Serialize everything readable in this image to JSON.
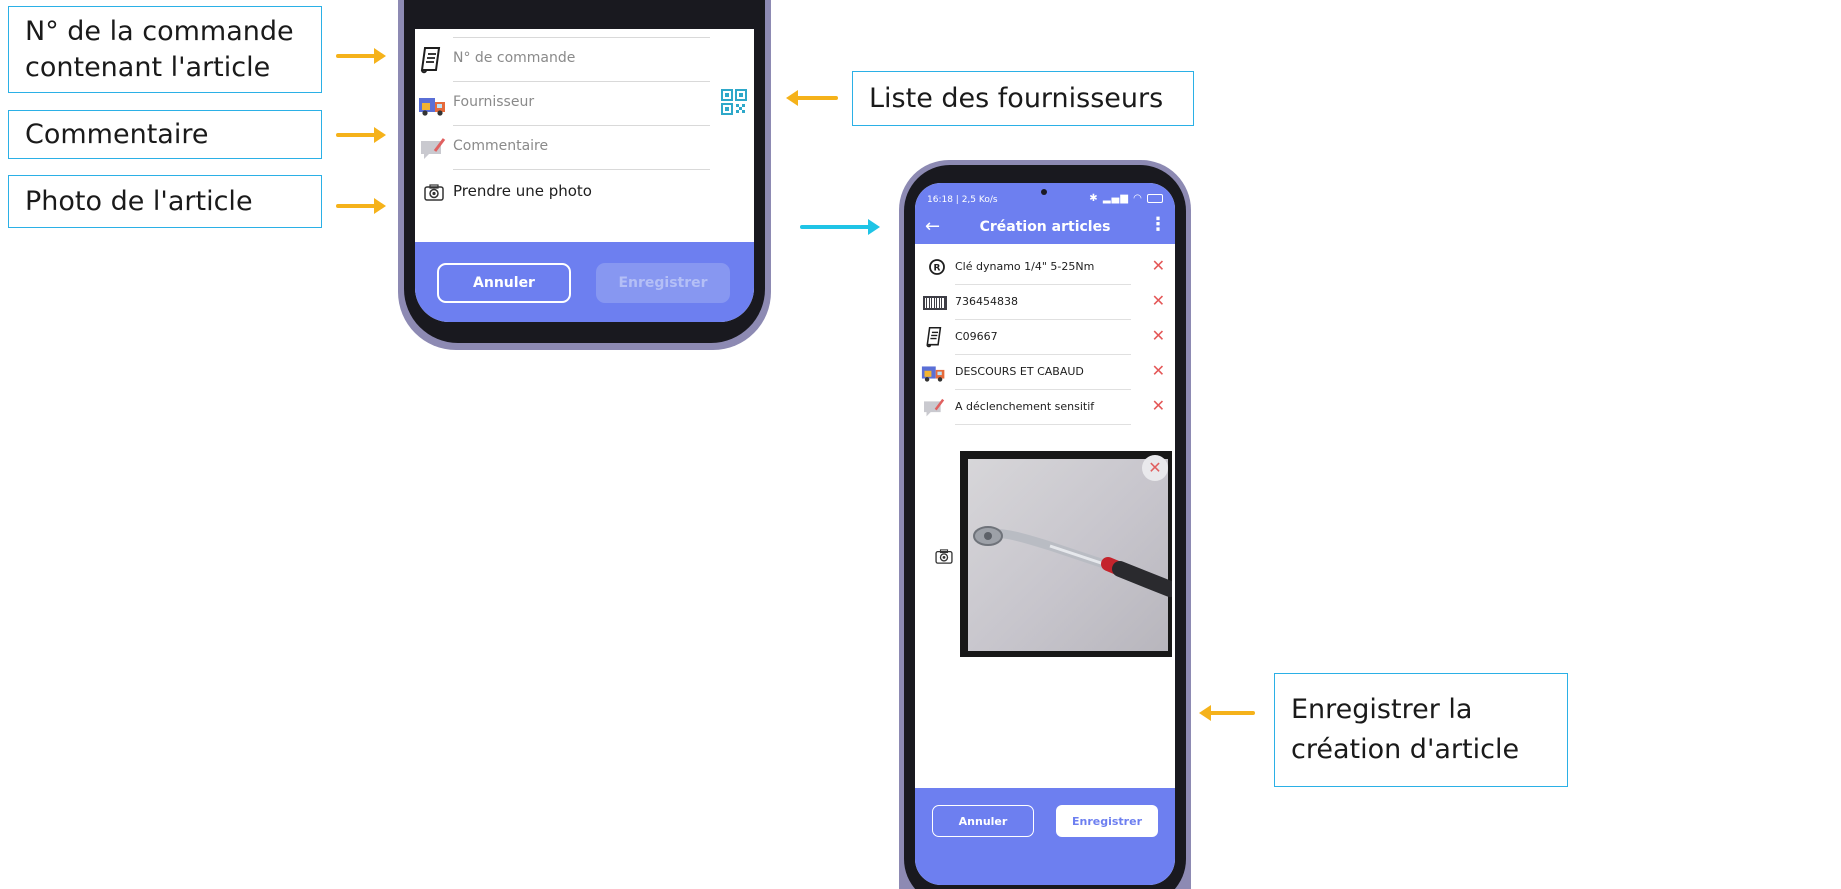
{
  "annotations": {
    "order_number": "N° de la commande\ncontenant l'article",
    "comment": "Commentaire",
    "photo": "Photo de l'article",
    "supplier_list": "Liste des fournisseurs",
    "save_creation": "Enregistrer la\ncréation d'article"
  },
  "phone1": {
    "fields": {
      "order_number_placeholder": "N° de commande",
      "supplier_placeholder": "Fournisseur",
      "comment_placeholder": "Commentaire",
      "take_photo": "Prendre une photo"
    },
    "buttons": {
      "cancel": "Annuler",
      "save": "Enregistrer"
    }
  },
  "phone2": {
    "status": {
      "time": "16:18 | 2,5 Ko/s"
    },
    "appbar": {
      "title": "Création articles"
    },
    "fields": {
      "reference": "Clé dynamo 1/4\" 5-25Nm",
      "barcode": "736454838",
      "order_number": "C09667",
      "supplier": "DESCOURS ET CABAUD",
      "comment": "A déclenchement sensitif"
    },
    "buttons": {
      "cancel": "Annuler",
      "save": "Enregistrer"
    }
  },
  "icons": {
    "order": "document-icon",
    "supplier": "supplier-truck-icon",
    "comment": "comment-icon",
    "camera": "camera-icon",
    "qr": "qr-code-icon",
    "reference": "registered-icon",
    "barcode": "barcode-icon",
    "remove": "close-icon",
    "back": "back-arrow-icon",
    "menu": "more-vertical-icon"
  },
  "colors": {
    "accent": "#6d7ff0",
    "callout_border": "#2bb0e6",
    "arrow_orange": "#f5b21a",
    "arrow_cyan": "#1fc4e6",
    "delete_red": "#e45757"
  }
}
